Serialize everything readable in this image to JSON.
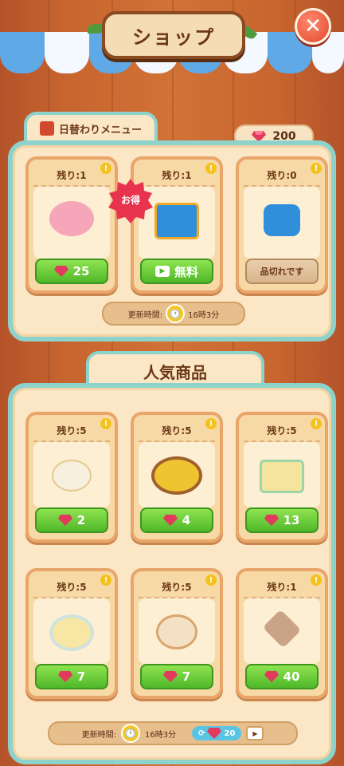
{
  "header": {
    "title": "ショップ",
    "close_icon": "close-icon"
  },
  "currency": {
    "gems": "200"
  },
  "daily": {
    "tab_label": "日替わりメニュー",
    "refresh_label": "更新時間:",
    "refresh_time": "16時3分",
    "items": [
      {
        "remaining": "残り:1",
        "price": "25",
        "type": "gem",
        "icon": "piggy-bank-icon"
      },
      {
        "remaining": "残り:1",
        "price": "無料",
        "type": "video",
        "icon": "treasure-chest-icon",
        "badge": "お得"
      },
      {
        "remaining": "残り:0",
        "price": "品切れです",
        "type": "soldout",
        "icon": "coin-bag-icon"
      }
    ]
  },
  "popular": {
    "title": "人気商品",
    "refresh_label": "更新時間:",
    "refresh_time": "16時3分",
    "refresh_cost": "20",
    "items": [
      {
        "remaining": "残り:5",
        "price": "2",
        "icon": "bun-icon"
      },
      {
        "remaining": "残り:5",
        "price": "4",
        "icon": "dumpling-basket-icon"
      },
      {
        "remaining": "残り:5",
        "price": "13",
        "icon": "tofu-cake-icon"
      },
      {
        "remaining": "残り:5",
        "price": "7",
        "icon": "egg-soup-icon"
      },
      {
        "remaining": "残り:5",
        "price": "7",
        "icon": "meat-bun-icon"
      },
      {
        "remaining": "残り:1",
        "price": "40",
        "icon": "wrapped-parcel-icon"
      }
    ]
  },
  "colors": {
    "accent_green": "#4fb82a",
    "frame_teal": "#8dd3cc",
    "gem_red": "#e23a5c"
  }
}
